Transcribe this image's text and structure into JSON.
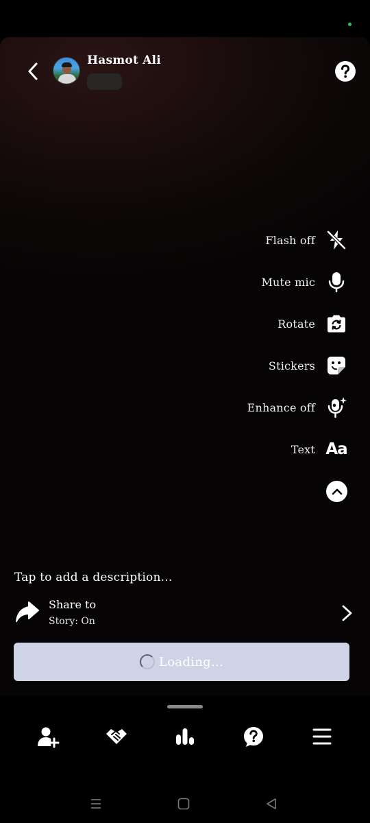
{
  "header": {
    "user_name": "Hasmot Ali"
  },
  "side_menu": [
    {
      "label": "Flash off",
      "icon": "flash-off-icon"
    },
    {
      "label": "Mute mic",
      "icon": "microphone-icon"
    },
    {
      "label": "Rotate",
      "icon": "rotate-camera-icon"
    },
    {
      "label": "Stickers",
      "icon": "sticker-icon"
    },
    {
      "label": "Enhance off",
      "icon": "enhance-icon"
    },
    {
      "label": "Text",
      "icon": "text-aa-icon"
    }
  ],
  "text_icon_glyph": "Aa",
  "description_placeholder": "Tap to add a description...",
  "share": {
    "title": "Share to",
    "subtitle": "Story: On"
  },
  "loading_button": {
    "label": "Loading..."
  },
  "bottom_nav": [
    {
      "icon": "add-friend-icon"
    },
    {
      "icon": "handshake-icon"
    },
    {
      "icon": "stats-bars-icon"
    },
    {
      "icon": "help-bubble-icon"
    },
    {
      "icon": "menu-icon"
    }
  ],
  "colors": {
    "accent_loading_bg": "#cfd3e6",
    "status_dot": "#27c46b",
    "panel_bg": "#0b0707"
  }
}
